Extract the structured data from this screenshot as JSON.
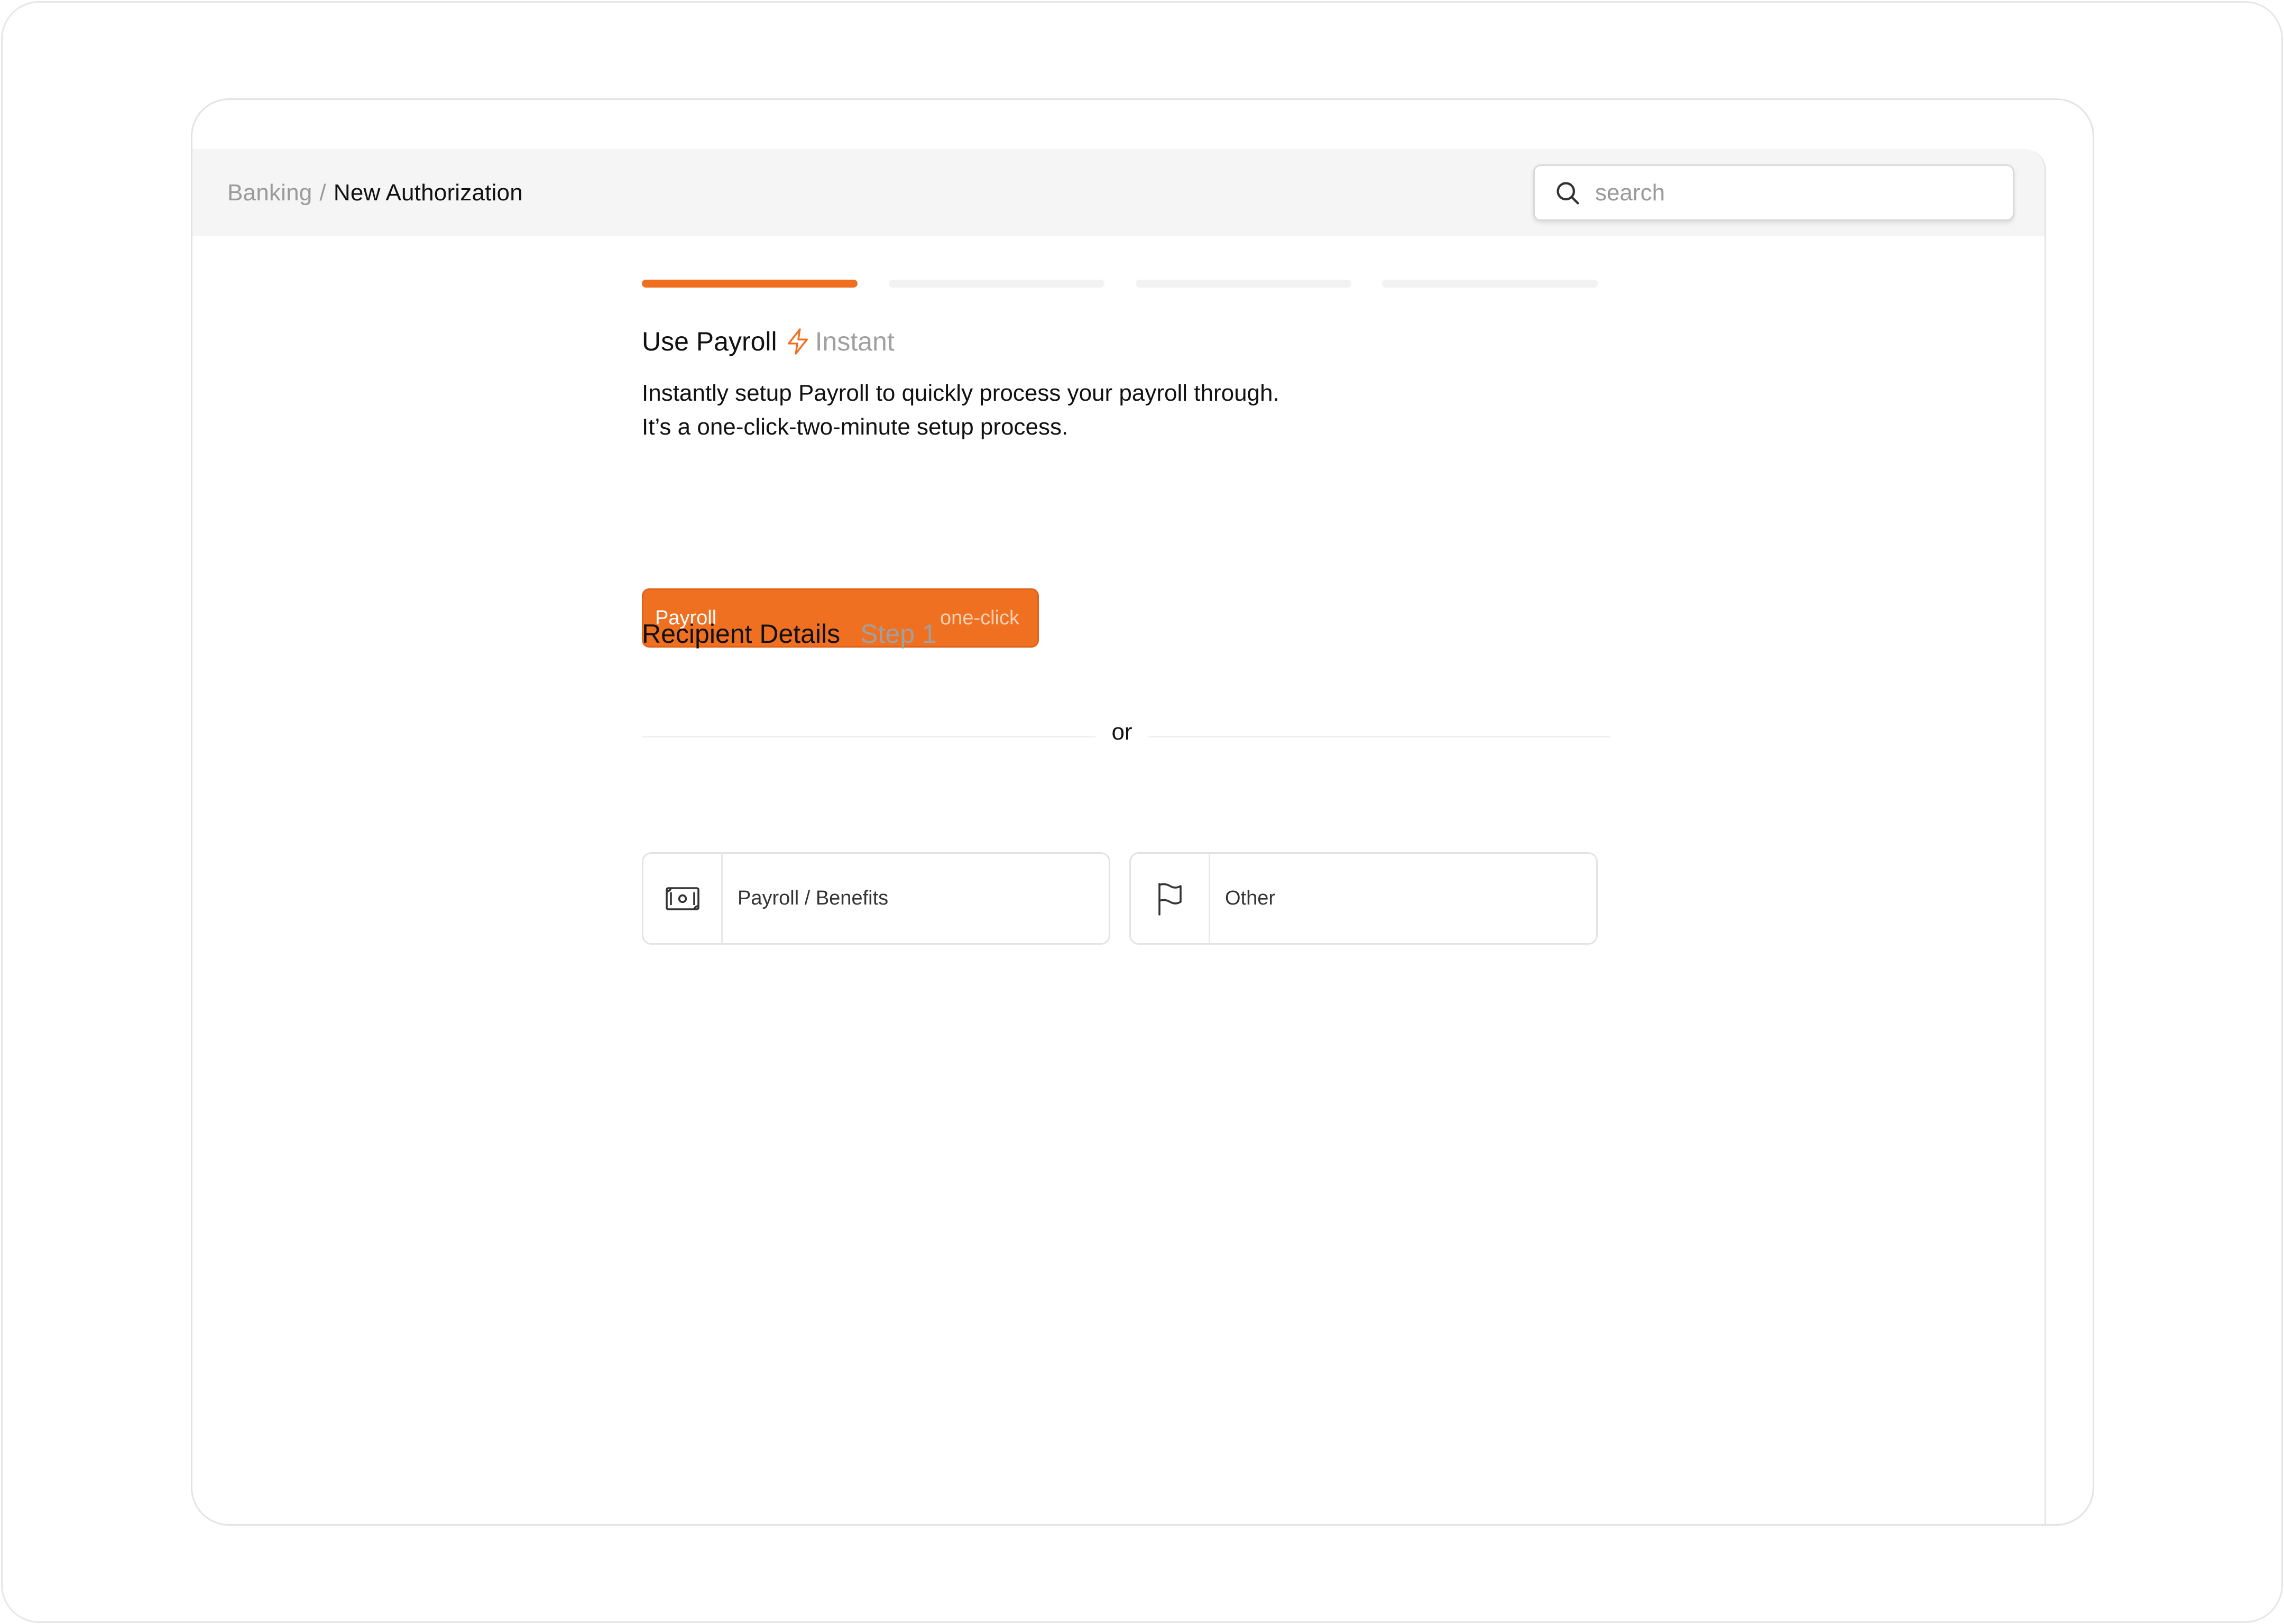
{
  "breadcrumb": {
    "parent": "Banking",
    "separator": "/",
    "current": "New Authorization"
  },
  "search": {
    "placeholder": "search",
    "icon": "search-icon"
  },
  "progress": {
    "total_steps": 4,
    "current_step": 1
  },
  "use_payroll": {
    "title": "Use Payroll",
    "badge_icon": "lightning-bolt-icon",
    "badge": "Instant",
    "description_line1": "Instantly setup Payroll to quickly process your payroll through.",
    "description_line2": "It’s a one-click-two-minute setup process.",
    "button_label": "Payroll",
    "button_tag": "one-click"
  },
  "divider": {
    "label": "or"
  },
  "recipient": {
    "title": "Recipient Details",
    "step": "Step 1",
    "options": [
      {
        "label": "Payroll / Benefits",
        "icon": "banknote-icon"
      },
      {
        "label": "Other",
        "icon": "flag-icon"
      }
    ]
  },
  "colors": {
    "accent": "#f07022",
    "muted_text": "#9a9a9a",
    "header_bg": "#f5f5f5"
  }
}
